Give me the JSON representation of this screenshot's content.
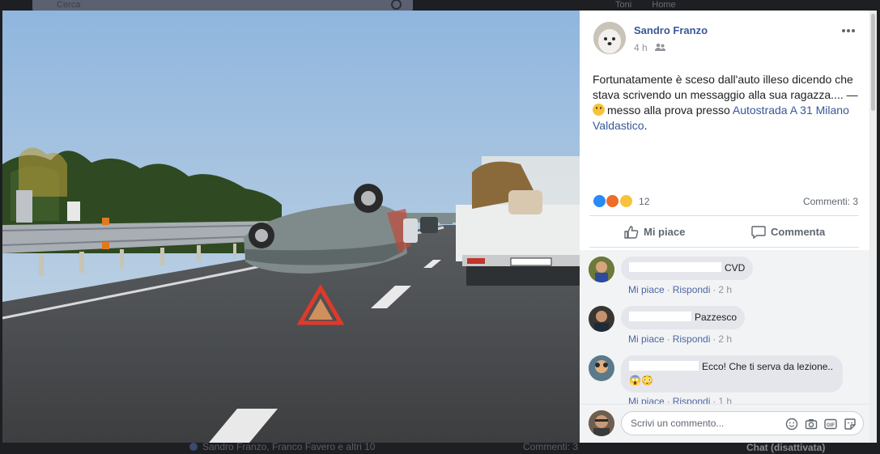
{
  "background": {
    "search_placeholder": "Cerca",
    "top_links": [
      "Toni",
      "Home"
    ],
    "bottom_reactors": "Sandro Franzo, Franco Favero e altri 10",
    "bottom_comments": "Commenti: 3",
    "chat_status": "Chat (disattivata)"
  },
  "post": {
    "author": "Sandro Franzo",
    "timestamp": "4 h",
    "audience_icon": "friends-icon",
    "text": "Fortunatamente è sceso dall'auto illeso dicendo che stava scrivendo un messaggio alla sua ragazza.... —",
    "activity_prefix": "messo alla prova presso",
    "location_link": "Autostrada A 31 Milano Valdastico",
    "activity_suffix": ".",
    "reaction_count": "12",
    "reaction_types": [
      "like-icon",
      "angry-icon",
      "wow-icon"
    ],
    "comments_count": "Commenti: 3"
  },
  "actions": {
    "like_label": "Mi piace",
    "comment_label": "Commenta"
  },
  "comments": [
    {
      "text": "CVD",
      "like": "Mi piace",
      "reply": "Rispondi",
      "time": "2 h"
    },
    {
      "text": "Pazzesco",
      "like": "Mi piace",
      "reply": "Rispondi",
      "time": "2 h"
    },
    {
      "text": "Ecco! Che ti serva da lezione..😱😳",
      "like": "Mi piace",
      "reply": "Rispondi",
      "time": "1 h"
    }
  ],
  "composer": {
    "placeholder": "Scrivi un commento..."
  },
  "colors": {
    "link": "#385898",
    "theater_bg": "#1e1f23",
    "like_blue": "#2a8af6"
  }
}
